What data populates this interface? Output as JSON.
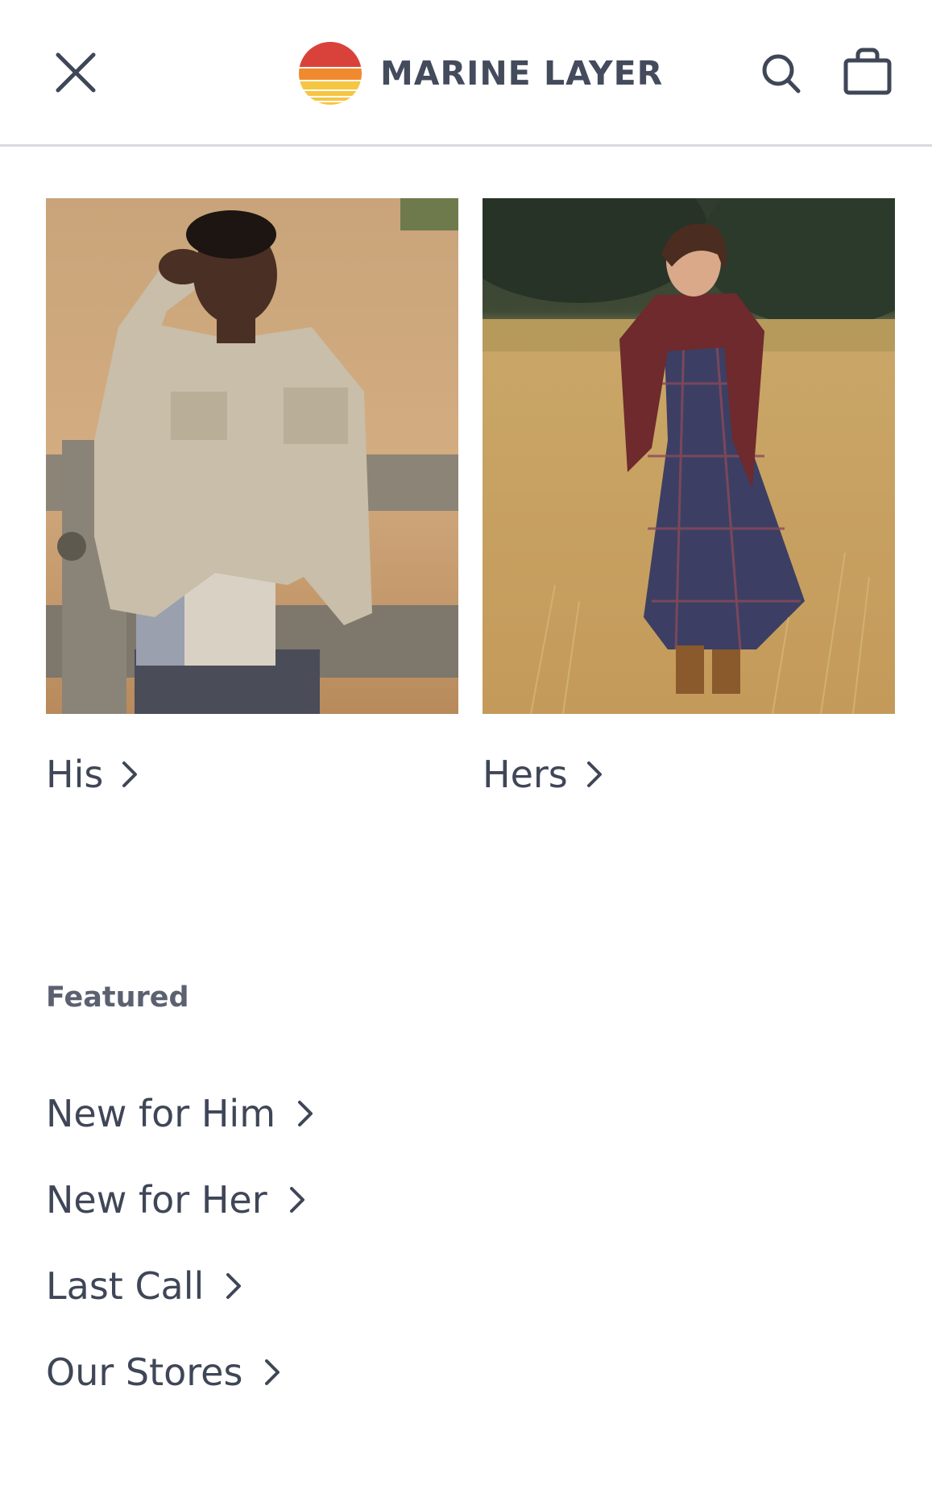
{
  "header": {
    "brand_name": "MARINE LAYER",
    "close_icon": "close-icon",
    "search_icon": "search-icon",
    "bag_icon": "shopping-bag-icon"
  },
  "categories": [
    {
      "label": "His",
      "icon": "chevron-right-icon"
    },
    {
      "label": "Hers",
      "icon": "chevron-right-icon"
    }
  ],
  "featured": {
    "heading": "Featured",
    "items": [
      {
        "label": "New for Him",
        "icon": "chevron-right-icon"
      },
      {
        "label": "New for Her",
        "icon": "chevron-right-icon"
      },
      {
        "label": "Last Call",
        "icon": "chevron-right-icon"
      },
      {
        "label": "Our Stores",
        "icon": "chevron-right-icon"
      }
    ]
  },
  "colors": {
    "text": "#3f4657",
    "logo_red": "#d9423a",
    "logo_orange": "#ef8a2f",
    "logo_yellow": "#f6c542",
    "divider": "#d9dadf"
  }
}
